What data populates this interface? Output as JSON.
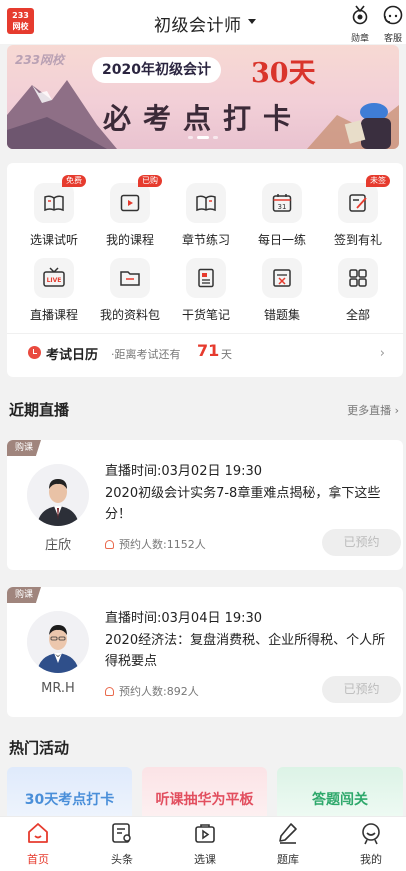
{
  "header": {
    "logo_text": "233网校",
    "title": "初级会计师",
    "right_buttons": [
      {
        "label": "勋章",
        "icon": "medal-icon"
      },
      {
        "label": "客服",
        "icon": "headset-icon"
      }
    ]
  },
  "banner": {
    "brand": "233网校",
    "pill": "2020年初级会计",
    "days": "30天",
    "headline": "必考点打卡",
    "page_count": 3,
    "active_page": 1
  },
  "menu": {
    "items": [
      {
        "label": "选课试听",
        "icon": "book-open-icon",
        "badge": "免费"
      },
      {
        "label": "我的课程",
        "icon": "video-play-icon",
        "badge": "已购"
      },
      {
        "label": "章节练习",
        "icon": "chapter-book-icon",
        "badge": ""
      },
      {
        "label": "每日一练",
        "icon": "calendar-icon",
        "badge": "",
        "icon_text": "31"
      },
      {
        "label": "签到有礼",
        "icon": "sign-in-icon",
        "badge": "未签"
      },
      {
        "label": "直播课程",
        "icon": "live-tv-icon",
        "badge": "",
        "icon_text": "LIVE"
      },
      {
        "label": "我的资料包",
        "icon": "folder-icon",
        "badge": ""
      },
      {
        "label": "干货笔记",
        "icon": "notes-icon",
        "badge": ""
      },
      {
        "label": "错题集",
        "icon": "wrong-questions-icon",
        "badge": ""
      },
      {
        "label": "全部",
        "icon": "grid-icon",
        "badge": ""
      }
    ],
    "exam": {
      "title": "考试日历",
      "prefix": "·距离考试还有",
      "days": "71",
      "unit": "天"
    }
  },
  "live_section": {
    "title": "近期直播",
    "more": "更多直播 ›",
    "cards": [
      {
        "tag": "购课",
        "teacher": "庄欣",
        "time": "直播时间:03月02日 19:30",
        "title": "2020初级会计实务7-8章重难点揭秘，拿下这些分！",
        "appointments": "预约人数:1152人",
        "button": "已预约"
      },
      {
        "tag": "购课",
        "teacher": "MR.H",
        "time": "直播时间:03月04日 19:30",
        "title": "2020经济法：复盘消费税、企业所得税、个人所得税要点",
        "appointments": "预约人数:892人",
        "button": "已预约"
      }
    ]
  },
  "activities": {
    "title": "热门活动",
    "items": [
      {
        "label": "30天考点打卡",
        "color": "#4a8fd9"
      },
      {
        "label": "听课抽华为平板",
        "color": "#e24f5f"
      },
      {
        "label": "答题闯关",
        "color": "#2ea86b"
      }
    ]
  },
  "tabbar": {
    "tabs": [
      {
        "label": "首页",
        "icon": "home-icon",
        "active": true
      },
      {
        "label": "头条",
        "icon": "news-icon",
        "active": false
      },
      {
        "label": "选课",
        "icon": "course-bag-icon",
        "active": false
      },
      {
        "label": "题库",
        "icon": "pencil-icon",
        "active": false
      },
      {
        "label": "我的",
        "icon": "profile-icon",
        "active": false
      }
    ]
  },
  "colors": {
    "accent": "#e63b2e",
    "background": "#f2f2f2",
    "tag": "#a0857d"
  }
}
